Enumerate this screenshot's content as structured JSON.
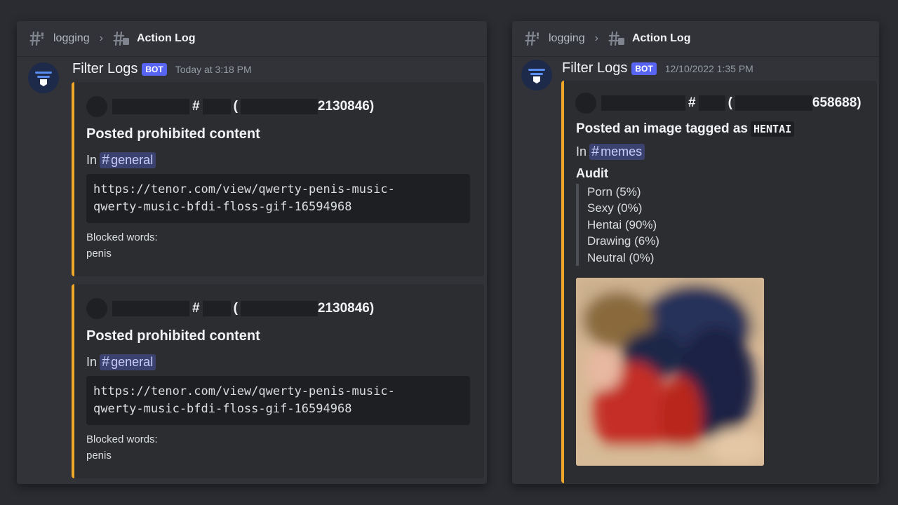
{
  "colors": {
    "embed_accent": "#f0a729",
    "bot_badge": "#5865f2",
    "mention_bg": "#3c4270"
  },
  "left": {
    "header": {
      "parent": "logging",
      "current": "Action Log"
    },
    "message": {
      "author": "Filter Logs",
      "tag": "BOT",
      "timestamp": "Today at 3:18 PM",
      "embeds": [
        {
          "author_hash": "#",
          "author_paren": "(",
          "author_id_tail": "2130846)",
          "title": "Posted prohibited content",
          "in_label": "In",
          "channel": "general",
          "code_line1": "https://tenor.com/view/qwerty-penis-music-",
          "code_line2": "qwerty-music-bfdi-floss-gif-16594968",
          "field_name": "Blocked words:",
          "field_value": "penis"
        },
        {
          "author_hash": "#",
          "author_paren": "(",
          "author_id_tail": "2130846)",
          "title": "Posted prohibited content",
          "in_label": "In",
          "channel": "general",
          "code_line1": "https://tenor.com/view/qwerty-penis-music-",
          "code_line2": "qwerty-music-bfdi-floss-gif-16594968",
          "field_name": "Blocked words:",
          "field_value": "penis"
        }
      ]
    }
  },
  "right": {
    "header": {
      "parent": "logging",
      "current": "Action Log"
    },
    "message": {
      "author": "Filter Logs",
      "tag": "BOT",
      "timestamp": "12/10/2022 1:35 PM",
      "embed": {
        "author_hash": "#",
        "author_paren": "(",
        "author_id_tail": "658688)",
        "title_prefix": "Posted an image tagged as",
        "title_tag": "HENTAI",
        "in_label": "In",
        "channel": "memes",
        "audit_title": "Audit",
        "audit": [
          "Porn (5%)",
          "Sexy (0%)",
          "Hentai (90%)",
          "Drawing (6%)",
          "Neutral (0%)"
        ]
      }
    }
  }
}
